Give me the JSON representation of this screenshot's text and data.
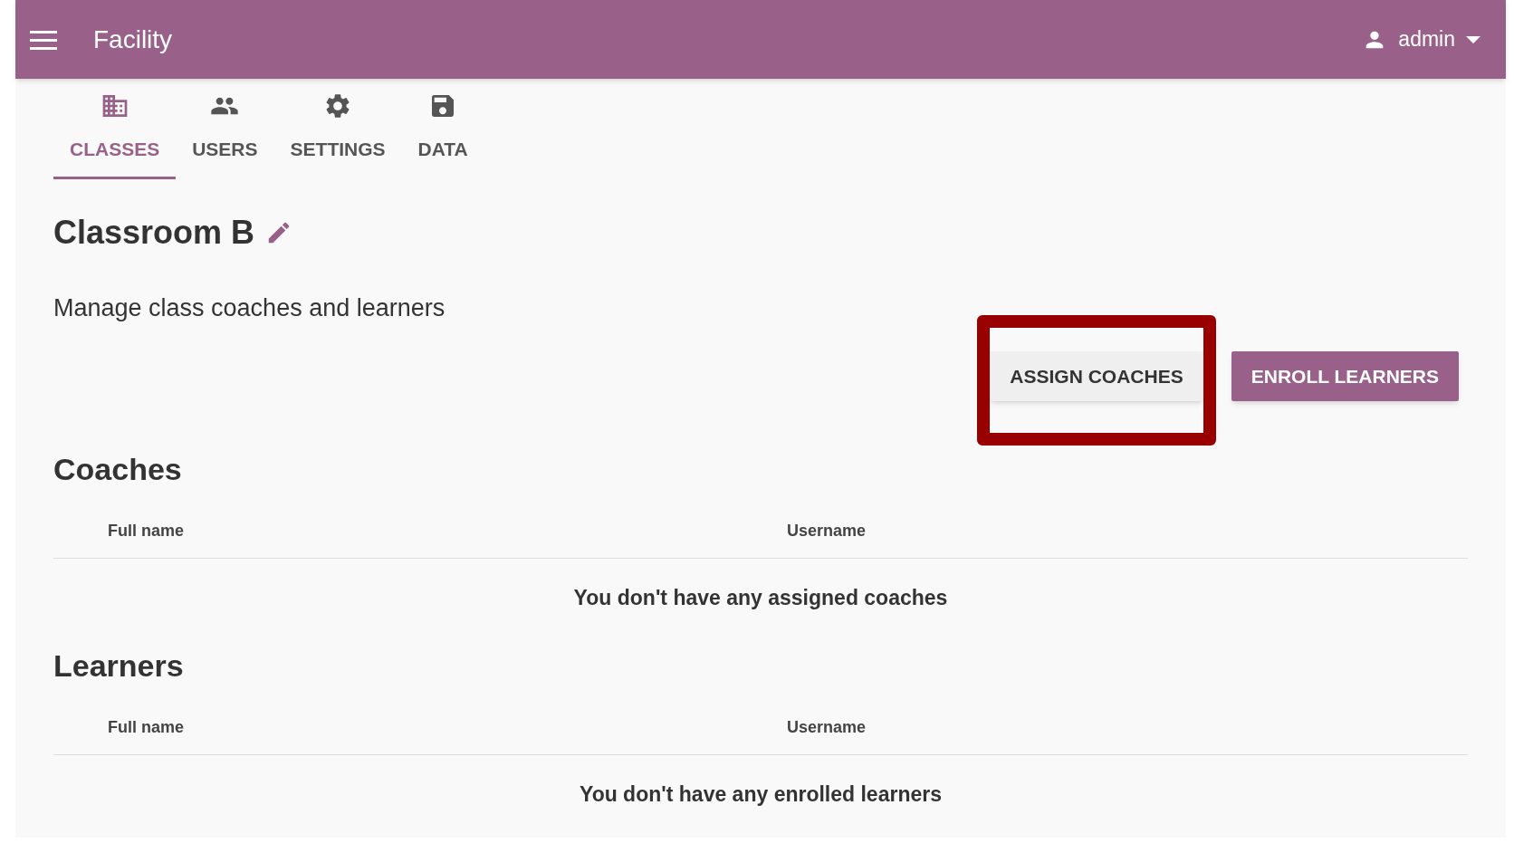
{
  "app_bar": {
    "title": "Facility",
    "user": "admin"
  },
  "tabs": [
    {
      "label": "CLASSES",
      "kind": "building",
      "selected": true
    },
    {
      "label": "USERS",
      "kind": "people",
      "selected": false
    },
    {
      "label": "SETTINGS",
      "kind": "gear",
      "selected": false
    },
    {
      "label": "DATA",
      "kind": "floppy",
      "selected": false
    }
  ],
  "class_title": "Classroom B",
  "subtitle": "Manage class coaches and learners",
  "buttons": [
    {
      "label": "ASSIGN COACHES",
      "kind": "secondary",
      "highlighted": true
    },
    {
      "label": "ENROLL LEARNERS",
      "kind": "primary",
      "highlighted": false
    }
  ],
  "sections": [
    {
      "heading": "Coaches",
      "columns": [
        "Full name",
        "Username"
      ],
      "empty_message": "You don't have any assigned coaches"
    },
    {
      "heading": "Learners",
      "columns": [
        "Full name",
        "Username"
      ],
      "empty_message": "You don't have any enrolled learners"
    }
  ]
}
